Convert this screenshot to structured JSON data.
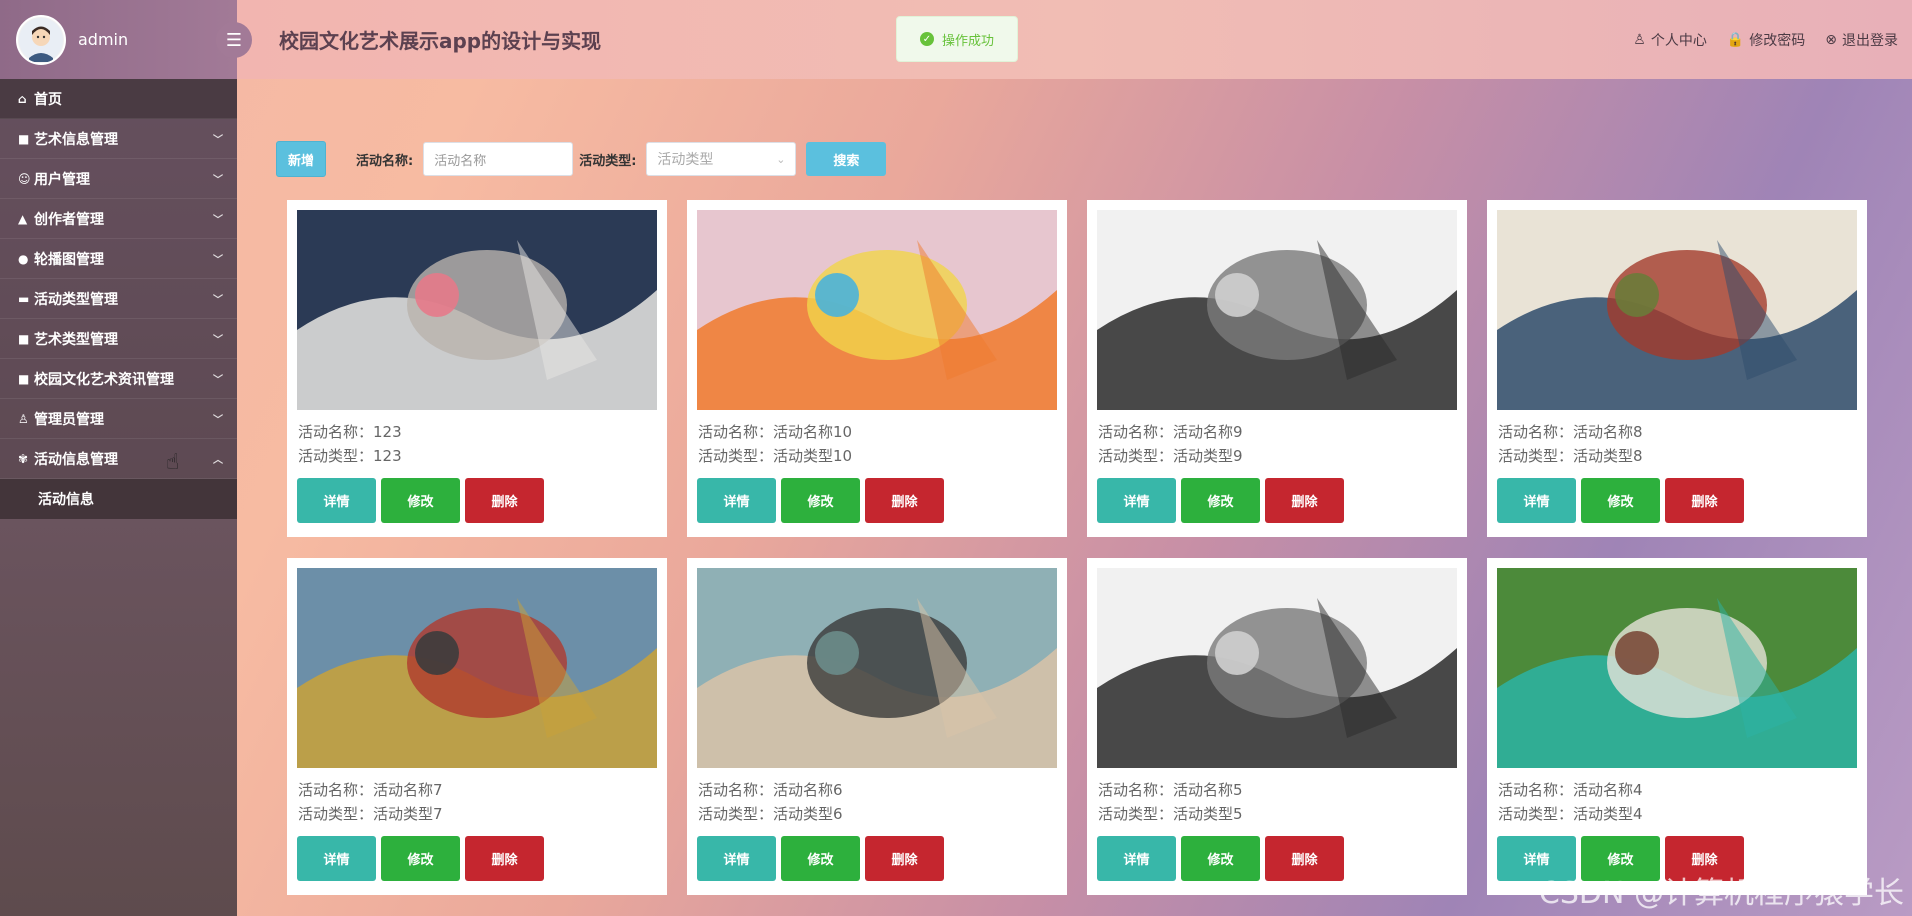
{
  "sidebar": {
    "username": "admin",
    "menu": [
      {
        "label": "首页",
        "icon": "home-icon",
        "glyph": "⌂",
        "expandable": false
      },
      {
        "label": "艺术信息管理",
        "icon": "grid-icon",
        "glyph": "■",
        "expandable": true
      },
      {
        "label": "用户管理",
        "icon": "user-icon",
        "glyph": "☺",
        "expandable": true
      },
      {
        "label": "创作者管理",
        "icon": "bank-icon",
        "glyph": "▲",
        "expandable": true
      },
      {
        "label": "轮播图管理",
        "icon": "circle-icon",
        "glyph": "●",
        "expandable": true
      },
      {
        "label": "活动类型管理",
        "icon": "briefcase-icon",
        "glyph": "▬",
        "expandable": true
      },
      {
        "label": "艺术类型管理",
        "icon": "grid-icon",
        "glyph": "■",
        "expandable": true
      },
      {
        "label": "校园文化艺术资讯管理",
        "icon": "grid-icon",
        "glyph": "■",
        "expandable": true
      },
      {
        "label": "管理员管理",
        "icon": "person-icon",
        "glyph": "♙",
        "expandable": true
      },
      {
        "label": "活动信息管理",
        "icon": "cogs-icon",
        "glyph": "✾",
        "expandable": true,
        "expanded": true
      }
    ],
    "submenu": [
      {
        "label": "活动信息"
      }
    ]
  },
  "header": {
    "title": "校园文化艺术展示app的设计与实现",
    "links": [
      {
        "label": "个人中心",
        "icon": "person-icon",
        "glyph": "♙"
      },
      {
        "label": "修改密码",
        "icon": "lock-icon",
        "glyph": "🔒"
      },
      {
        "label": "退出登录",
        "icon": "close-circle-icon",
        "glyph": "⊗"
      }
    ]
  },
  "toast": {
    "message": "操作成功"
  },
  "toolbar": {
    "add_label": "新增",
    "name_label": "活动名称:",
    "name_placeholder": "活动名称",
    "type_label": "活动类型:",
    "type_placeholder": "活动类型",
    "search_label": "搜索"
  },
  "card_buttons": {
    "detail": "详情",
    "edit": "修改",
    "delete": "删除"
  },
  "cards": [
    {
      "name": "活动名称：123",
      "type": "活动类型：123",
      "image": "husky-puppy-image",
      "colors": [
        "#2b3a55",
        "#e8e6e3",
        "#b9b3ad",
        "#e67a8a"
      ]
    },
    {
      "name": "活动名称：活动名称10",
      "type": "活动类型：活动类型10",
      "image": "floral-painting-image",
      "colors": [
        "#e7c6cf",
        "#f07a2d",
        "#f1d44a",
        "#4ab3d9"
      ]
    },
    {
      "name": "活动名称：活动名称9",
      "type": "活动类型：活动类型9",
      "image": "ink-tree-drawing-image",
      "colors": [
        "#f1f1f1",
        "#2a2a2a",
        "#7a7a7a",
        "#cfcfcf"
      ]
    },
    {
      "name": "活动名称：活动名称8",
      "type": "活动类型：活动类型8",
      "image": "mountain-painting-image",
      "colors": [
        "#e9e3d6",
        "#2e4b6b",
        "#a33b2c",
        "#6b7b3a"
      ]
    },
    {
      "name": "活动名称：活动名称7",
      "type": "活动类型：活动类型7",
      "image": "artist-girl-painting-image",
      "colors": [
        "#6c8fa8",
        "#c9a238",
        "#b03a2e",
        "#3c3c3c"
      ]
    },
    {
      "name": "活动名称：活动名称6",
      "type": "活动类型：活动类型6",
      "image": "surreal-woman-painting-image",
      "colors": [
        "#8fb0b5",
        "#d9c3a8",
        "#3a3a3a",
        "#6c8c89"
      ]
    },
    {
      "name": "活动名称：活动名称5",
      "type": "活动类型：活动类型5",
      "image": "ink-tree-drawing-image",
      "colors": [
        "#f1f1f1",
        "#2a2a2a",
        "#7a7a7a",
        "#cfcfcf"
      ]
    },
    {
      "name": "活动名称：活动名称4",
      "type": "活动类型：活动类型4",
      "image": "graffiti-eyes-image",
      "colors": [
        "#4c8a3a",
        "#2bb3a5",
        "#e6e2da",
        "#7a4a3a"
      ]
    }
  ],
  "watermark": "CSDN @计算机程序猿学长"
}
